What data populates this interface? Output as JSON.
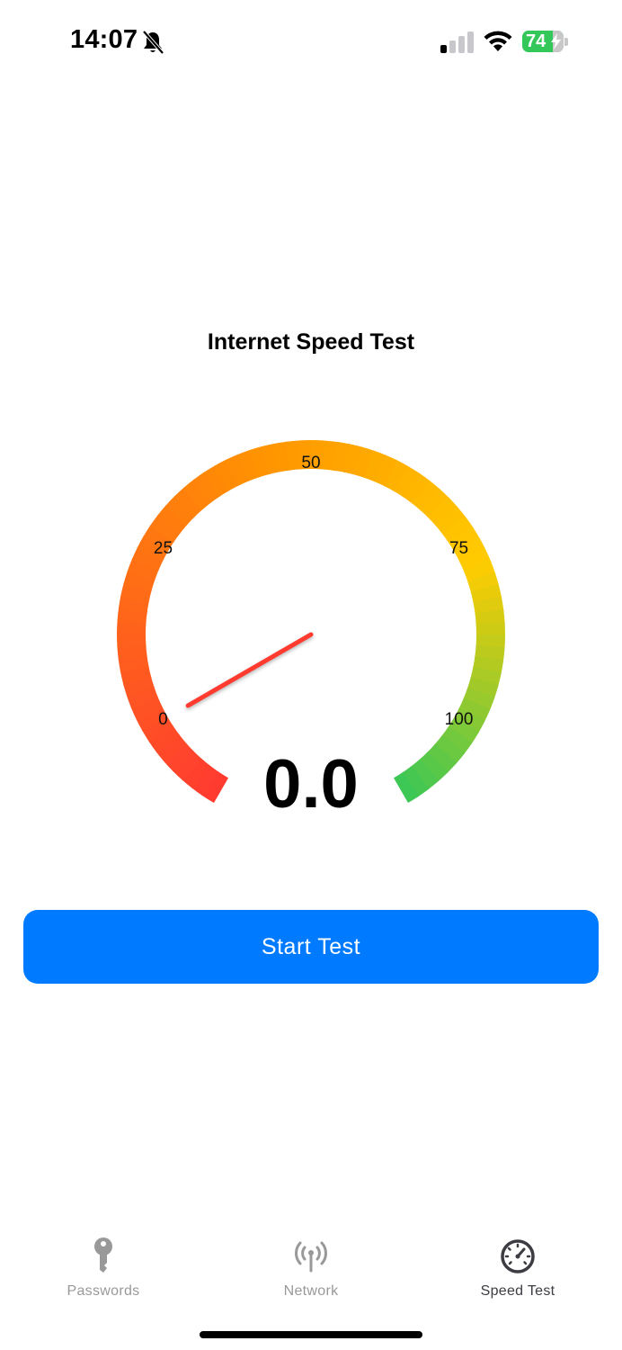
{
  "status_bar": {
    "time": "14:07",
    "battery_level": "74",
    "battery_color": "#34c759",
    "icons": [
      "bell-slash-icon",
      "cellular-signal-icon",
      "wifi-icon",
      "battery-charging-icon"
    ]
  },
  "title": "Internet Speed Test",
  "gauge": {
    "value": "0.0",
    "tick_labels": [
      "0",
      "25",
      "50",
      "75",
      "100"
    ],
    "min": 0,
    "max": 100,
    "gradient_colors": [
      "#ff3b30",
      "#ff9500",
      "#ffcc00",
      "#34c759"
    ],
    "needle_color": "#ff3b30"
  },
  "actions": {
    "start_label": "Start Test",
    "accent": "#007aff"
  },
  "tabs": [
    {
      "label": "Passwords",
      "icon": "key-icon",
      "active": false
    },
    {
      "label": "Network",
      "icon": "antenna-icon",
      "active": false
    },
    {
      "label": "Speed Test",
      "icon": "speedometer-icon",
      "active": true
    }
  ]
}
